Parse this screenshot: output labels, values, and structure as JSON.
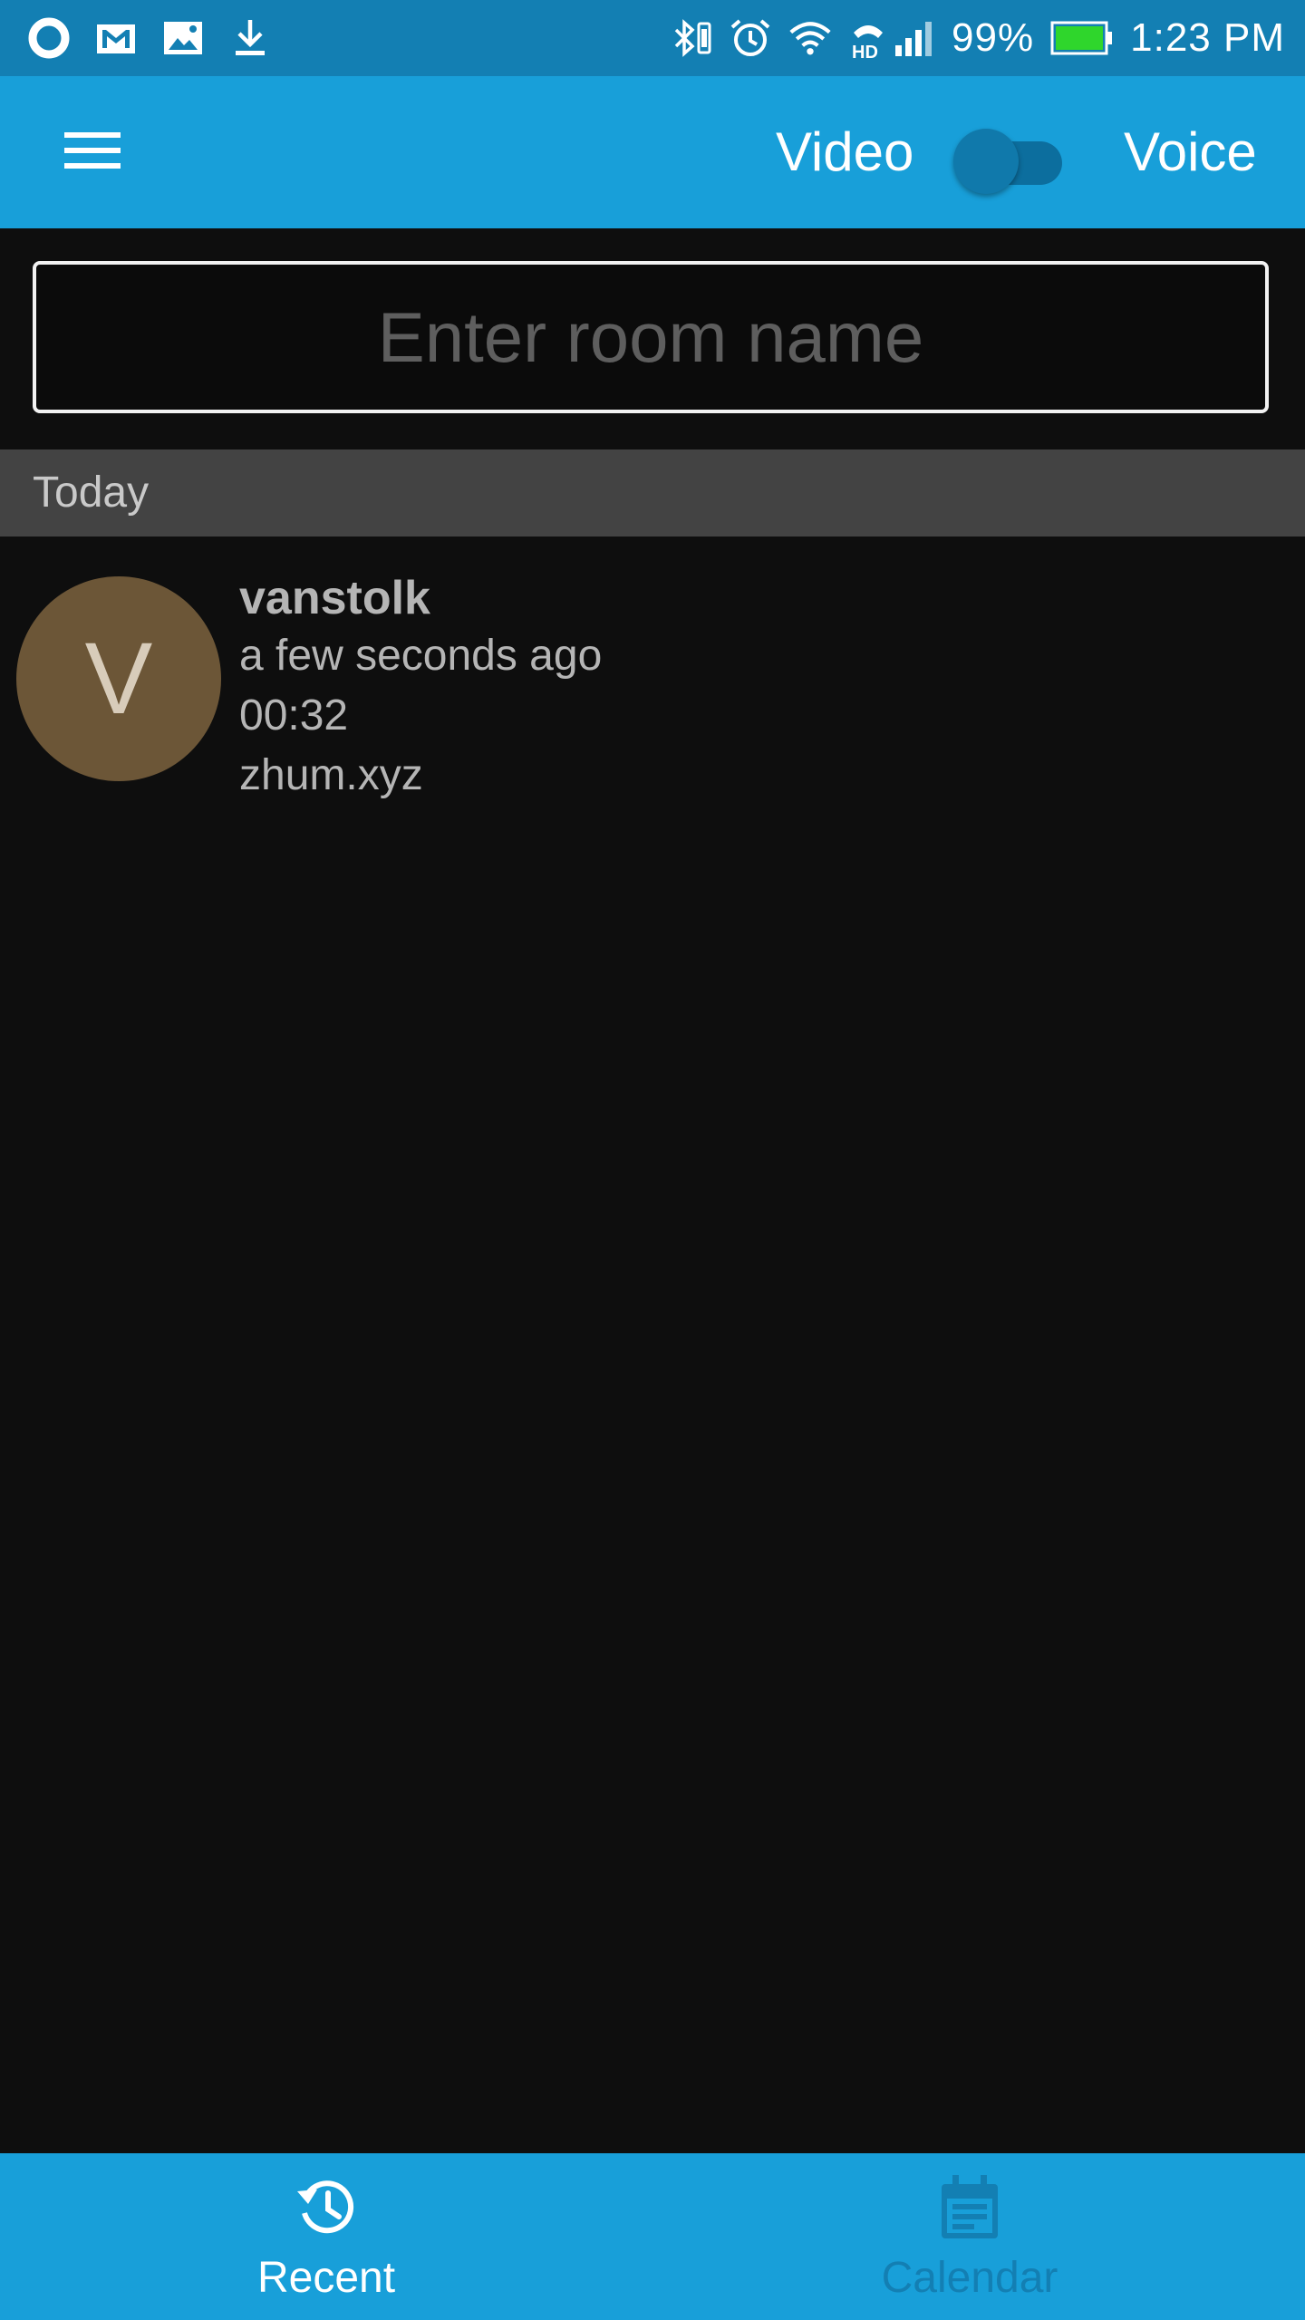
{
  "status_bar": {
    "battery_percent": "99%",
    "time": "1:23 PM",
    "battery_color": "#2fd62c",
    "left_icons": [
      "notification-ring-icon",
      "gmail-icon",
      "image-icon",
      "download-icon"
    ],
    "right_icons": [
      "bluetooth-icon",
      "alarm-icon",
      "wifi-icon",
      "hd-call-icon",
      "cell-signal-icon",
      "battery-icon"
    ]
  },
  "app_bar": {
    "menu_icon": "menu-icon",
    "mode_left_label": "Video",
    "mode_right_label": "Voice",
    "toggle_state": "off"
  },
  "room": {
    "placeholder": "Enter room name",
    "value": ""
  },
  "history": {
    "section_label": "Today",
    "items": [
      {
        "avatar_letter": "V",
        "avatar_color": "#6c5637",
        "name": "vanstolk",
        "time": "a few seconds ago",
        "duration": "00:32",
        "domain": "zhum.xyz"
      }
    ]
  },
  "bottom_nav": {
    "tabs": [
      {
        "label": "Recent",
        "icon": "history-icon",
        "active": true
      },
      {
        "label": "Calendar",
        "icon": "calendar-icon",
        "active": false
      }
    ]
  },
  "colors": {
    "status_bar": "#137fb3",
    "primary": "#189fd9",
    "background": "#0e0e0e",
    "section_header": "#434343",
    "inactive_tab": "#137fb3"
  }
}
